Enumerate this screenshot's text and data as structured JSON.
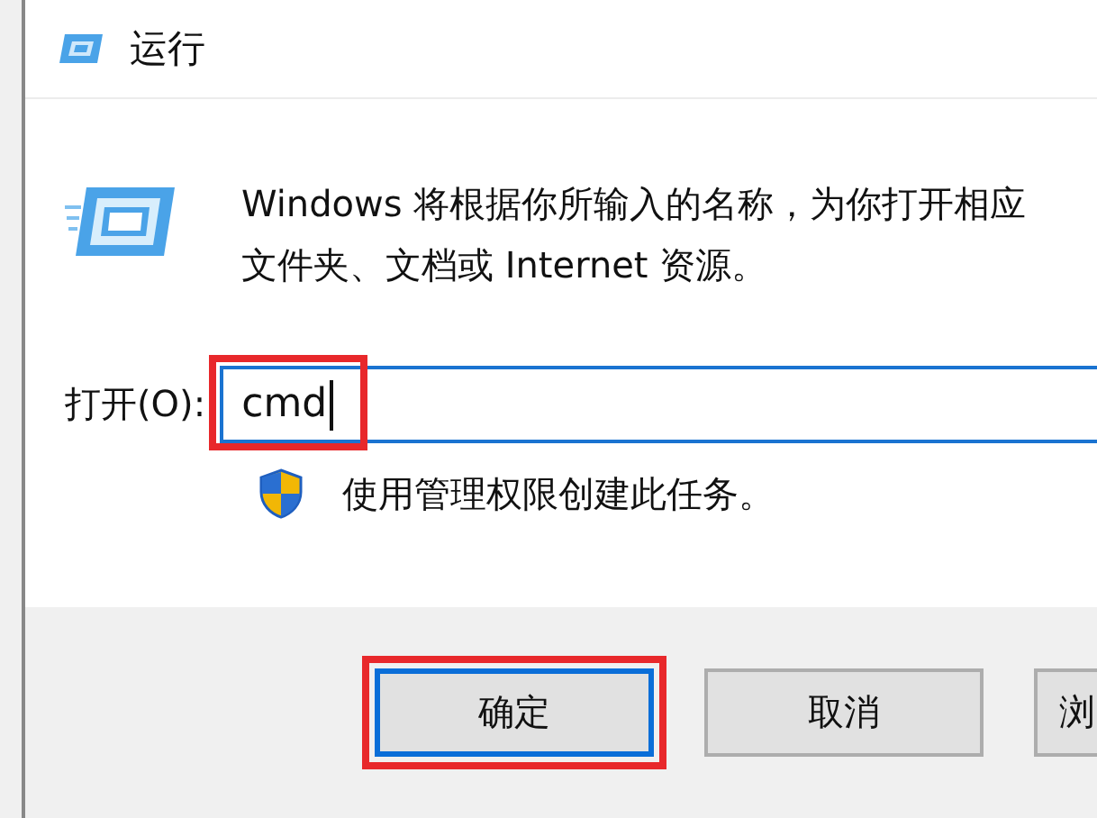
{
  "window": {
    "title": "运行"
  },
  "description": [
    "Windows 将根据你所输入的名称，为你打开相应",
    "文件夹、文档或 Internet 资源。"
  ],
  "open_field": {
    "label": "打开(O):",
    "value": "cmd",
    "focused": true,
    "highlighted": true
  },
  "admin_note": "使用管理权限创建此任务。",
  "buttons": [
    {
      "label": "确定",
      "default": true,
      "highlighted": true
    },
    {
      "label": "取消",
      "default": false,
      "highlighted": false
    },
    {
      "label": "浏",
      "default": false,
      "highlighted": false
    }
  ]
}
